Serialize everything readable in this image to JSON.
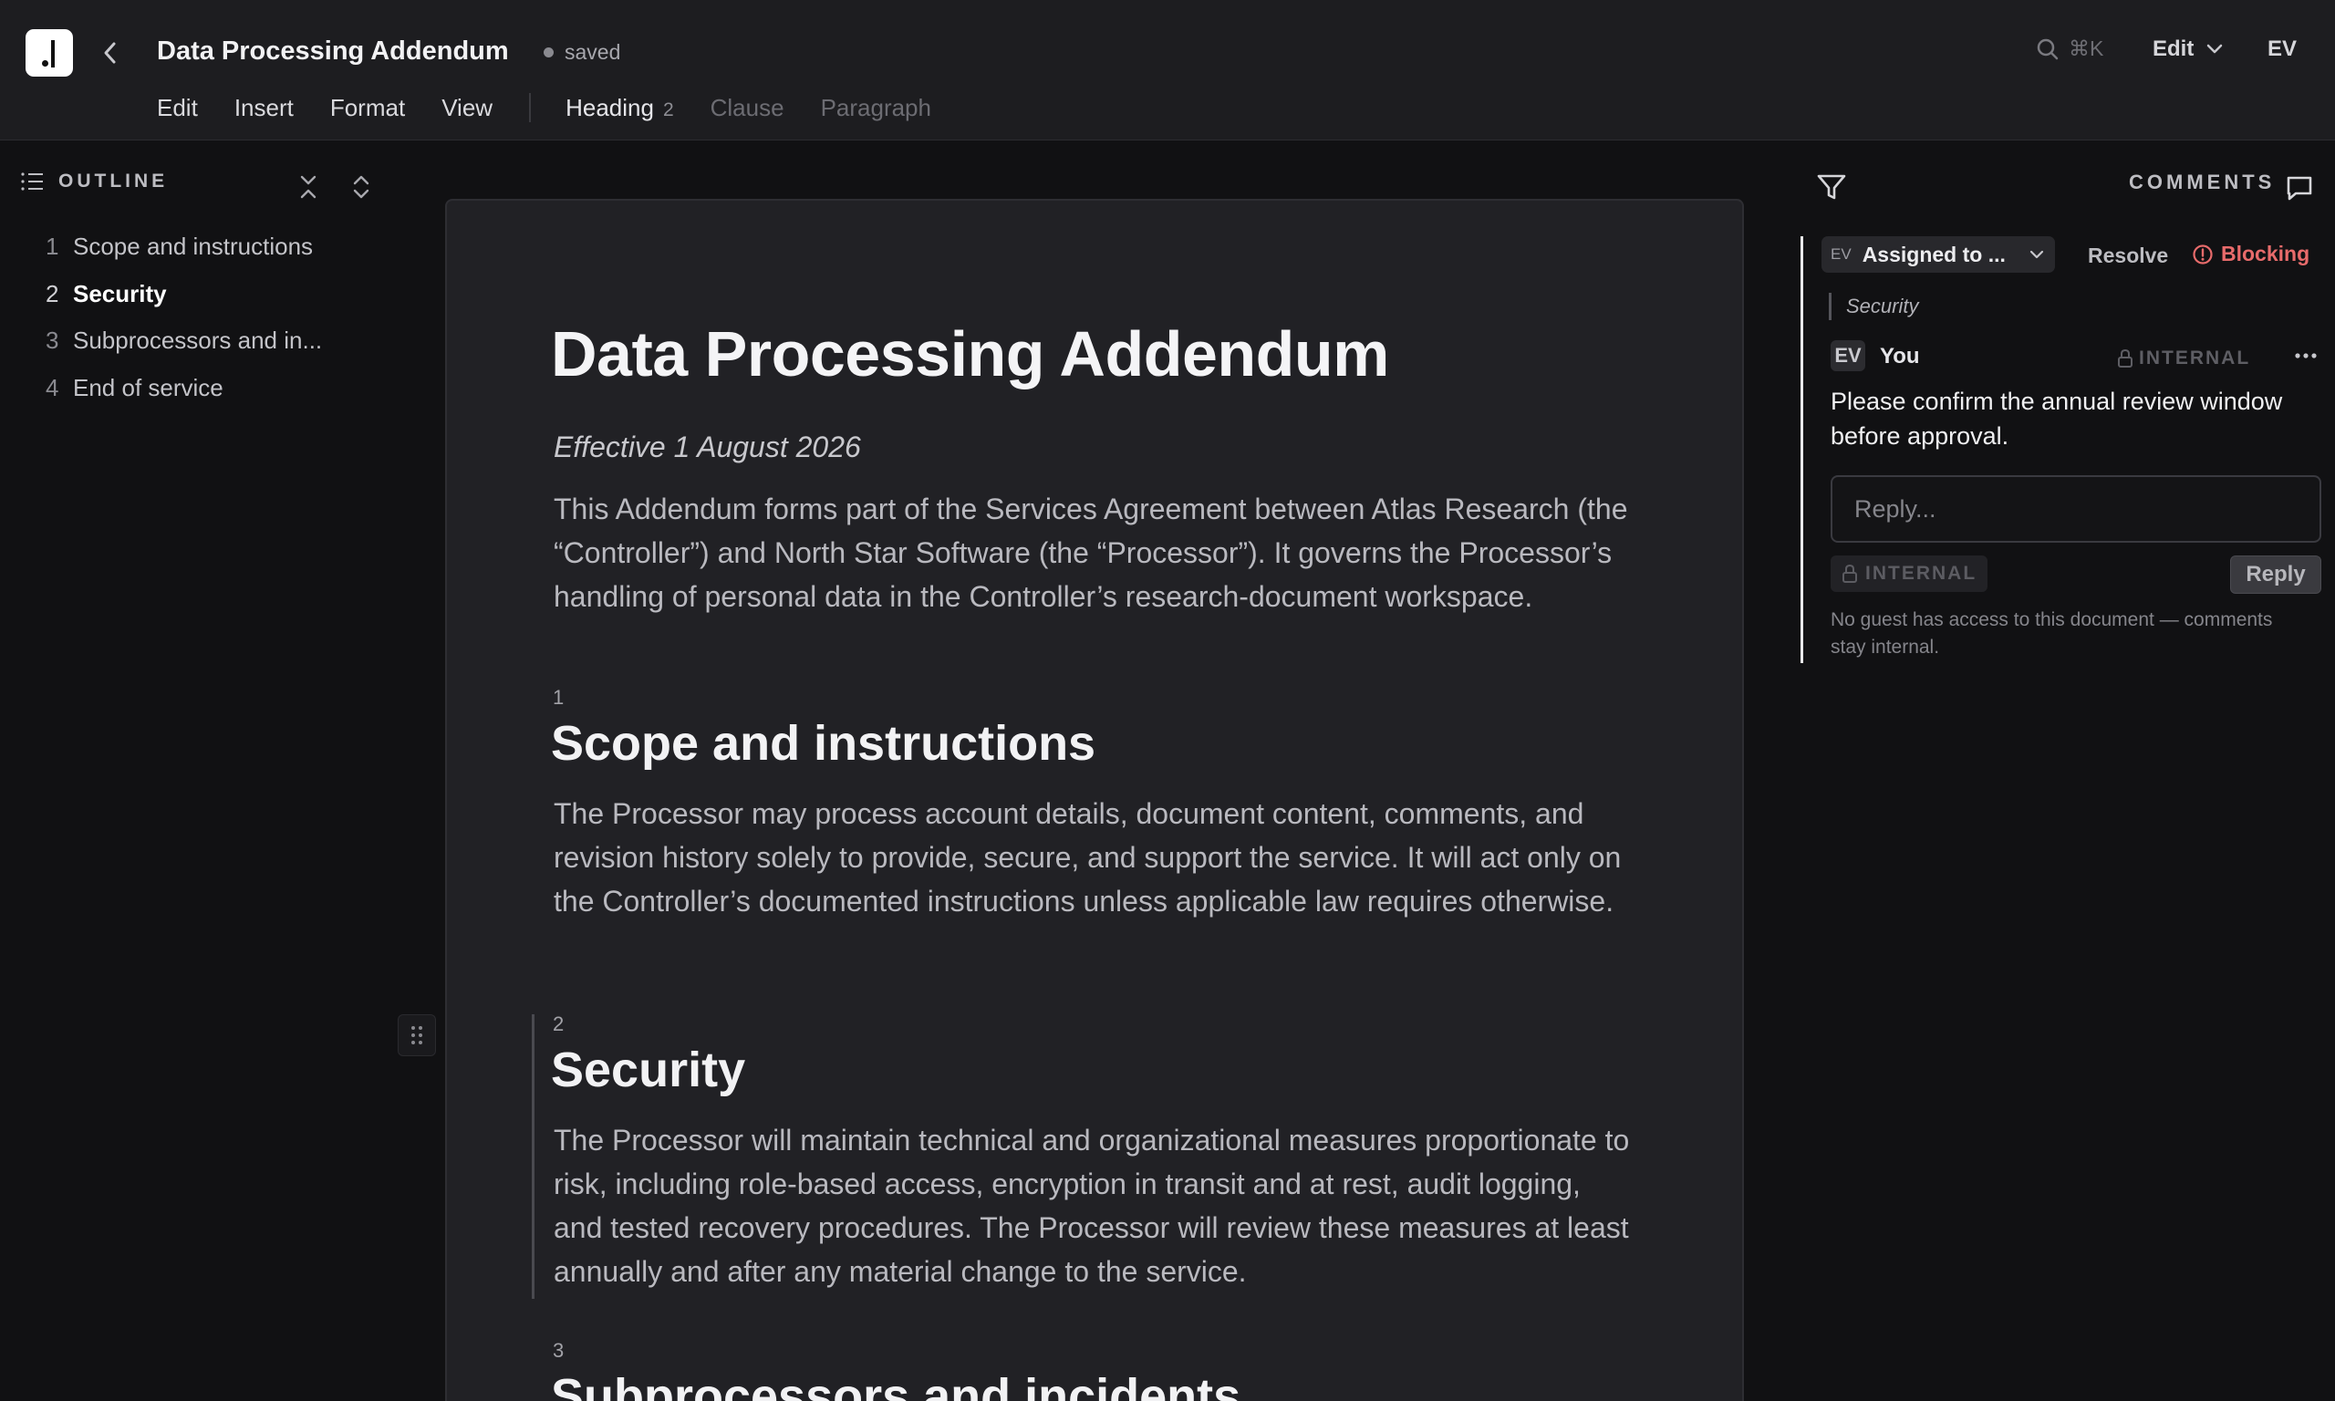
{
  "header": {
    "title": "Data Processing Addendum",
    "save_status": "saved",
    "search_shortcut": "⌘K",
    "mode_label": "Edit",
    "user_initials": "EV"
  },
  "menu": {
    "items": [
      "Edit",
      "Insert",
      "Format",
      "View"
    ],
    "current_style": "Heading",
    "current_style_level": "2",
    "styles": [
      "Clause",
      "Paragraph"
    ]
  },
  "outline": {
    "title": "OUTLINE",
    "items": [
      {
        "num": "1",
        "label": "Scope and instructions"
      },
      {
        "num": "2",
        "label": "Security"
      },
      {
        "num": "3",
        "label": "Subprocessors and in..."
      },
      {
        "num": "4",
        "label": "End of service"
      }
    ],
    "active_index": 1
  },
  "document": {
    "title": "Data Processing Addendum",
    "effective": "Effective 1 August 2026",
    "intro": "This Addendum forms part of the Services Agreement between Atlas Research (the “Controller”) and North Star Software (the “Processor”). It governs the Processor’s handling of personal data in the Controller’s research-document workspace.",
    "sections": [
      {
        "num": "1",
        "heading": "Scope and instructions",
        "body": "The Processor may process account details, document content, comments, and revision history solely to provide, secure, and support the service. It will act only on the Controller’s documented instructions unless applicable law requires otherwise."
      },
      {
        "num": "2",
        "heading": "Security",
        "body": "The Processor will maintain technical and organizational measures proportionate to risk, including role-based access, encryption in transit and at rest, audit logging, and tested recovery procedures. The Processor will review these measures at least annually and after any material change to the service."
      },
      {
        "num": "3",
        "heading": "Subprocessors and incidents",
        "body": ""
      }
    ]
  },
  "comments": {
    "title": "COMMENTS",
    "thread": {
      "assignee_initials": "EV",
      "assignee_label": "Assigned to ...",
      "resolve_label": "Resolve",
      "blocking_label": "Blocking",
      "quote": "Security",
      "author_initials": "EV",
      "author": "You",
      "visibility": "INTERNAL",
      "body": "Please confirm the annual review window before approval.",
      "reply_placeholder": "Reply...",
      "reply_visibility": "INTERNAL",
      "reply_label": "Reply",
      "note": "No guest has access to this document — comments stay internal."
    }
  },
  "colors": {
    "blocking": "#e86b6b",
    "background": "#111113",
    "page": "#212125"
  }
}
